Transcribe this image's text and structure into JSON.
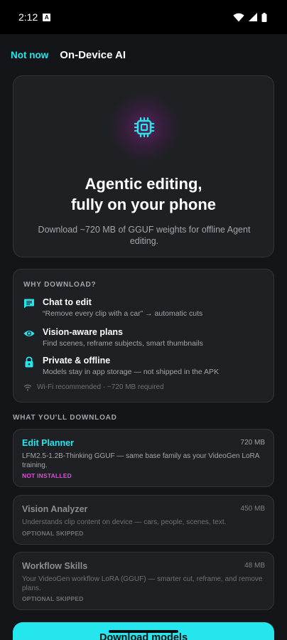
{
  "status_bar": {
    "time": "2:12",
    "notification_glyph": "A",
    "icons": [
      "wifi-icon",
      "signal-icon",
      "battery-icon"
    ]
  },
  "top_bar": {
    "not_now_label": "Not now",
    "title": "On-Device AI"
  },
  "hero": {
    "icon": "chip-icon",
    "title_line1": "Agentic editing,",
    "title_line2": "fully on your phone",
    "subtitle": "Download ~720 MB of GGUF weights for offline Agent editing."
  },
  "why": {
    "heading": "WHY DOWNLOAD?",
    "features": [
      {
        "icon": "chat-icon",
        "title": "Chat to edit",
        "desc": "“Remove every clip with a car” → automatic cuts"
      },
      {
        "icon": "eye-icon",
        "title": "Vision-aware plans",
        "desc": "Find scenes, reframe subjects, smart thumbnails"
      },
      {
        "icon": "lock-icon",
        "title": "Private & offline",
        "desc": "Models stay in app storage — not shipped in the APK"
      }
    ],
    "footer": "Wi-Fi recommended · ~720 MB required"
  },
  "download_section": {
    "heading": "WHAT YOU'LL DOWNLOAD",
    "models": [
      {
        "name": "Edit Planner",
        "size": "720 MB",
        "desc": "LFM2.5-1.2B-Thinking GGUF — same base family as your VideoGen LoRA training.",
        "status": "NOT INSTALLED"
      },
      {
        "name": "Vision Analyzer",
        "size": "450 MB",
        "desc": "Understands clip content on device — cars, people, scenes, text.",
        "status": "OPTIONAL SKIPPED"
      },
      {
        "name": "Workflow Skills",
        "size": "48 MB",
        "desc": "Your VideoGen workflow LoRA (GGUF) — smarter cut, reframe, and remove plans.",
        "status": "OPTIONAL SKIPPED"
      }
    ]
  },
  "primary_button": {
    "label": "Download models"
  },
  "colors": {
    "accent": "#25e6ec",
    "status_magenta": "#d94fd9",
    "background": "#141518",
    "card": "#1f2024"
  }
}
